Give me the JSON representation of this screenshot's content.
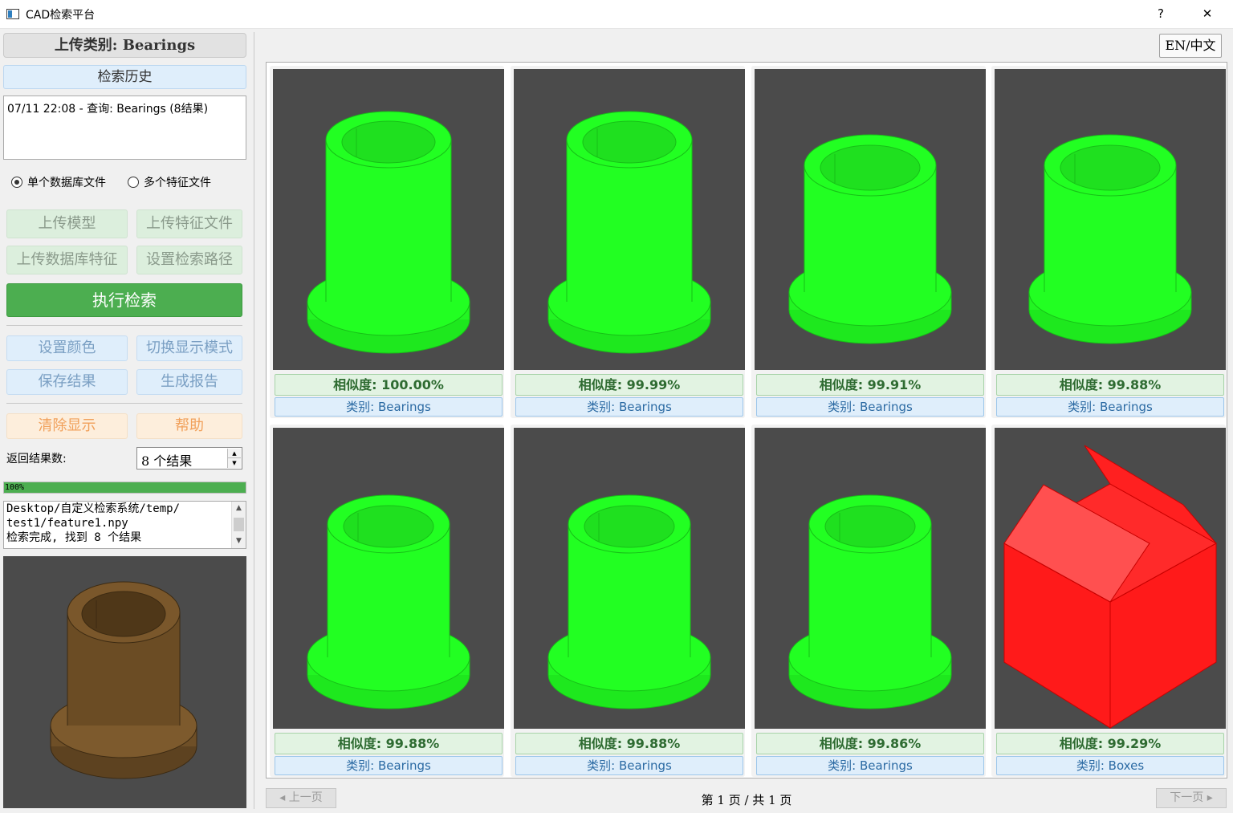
{
  "window": {
    "title": "CAD检索平台",
    "help": "?",
    "close": "✕"
  },
  "sidebar": {
    "upload_category": "上传类别: Bearings",
    "history_header": "检索历史",
    "history": [
      "07/11 22:08 - 查询: Bearings (8结果)"
    ],
    "radio_single": "单个数据库文件",
    "radio_multi": "多个特征文件",
    "radio_selected": "single",
    "btn_upload_model": "上传模型",
    "btn_upload_feature": "上传特征文件",
    "btn_upload_db_feature": "上传数据库特征",
    "btn_set_path": "设置检索路径",
    "btn_run": "执行检索",
    "btn_set_color": "设置颜色",
    "btn_toggle_display": "切换显示模式",
    "btn_save": "保存结果",
    "btn_report": "生成报告",
    "btn_clear": "清除显示",
    "btn_help": "帮助",
    "result_count_label": "返回结果数:",
    "result_count_value": "8 个结果",
    "progress_percent": 100,
    "progress_text": "100%",
    "log_lines": [
      "Desktop/自定义检索系统/temp/",
      "test1/feature1.npy",
      "检索完成, 找到 8 个结果"
    ],
    "colors": {
      "run_button": "#4cae50",
      "preview_model": "#6b4c24"
    }
  },
  "main": {
    "lang_toggle": "EN/中文",
    "results": [
      {
        "similarity": "相似度: 100.00%",
        "category": "类别: Bearings",
        "shape": "bearing-tall",
        "color": "#22ff22"
      },
      {
        "similarity": "相似度: 99.99%",
        "category": "类别: Bearings",
        "shape": "bearing-tall",
        "color": "#22ff22"
      },
      {
        "similarity": "相似度: 99.91%",
        "category": "类别: Bearings",
        "shape": "bearing-short",
        "color": "#22ff22"
      },
      {
        "similarity": "相似度: 99.88%",
        "category": "类别: Bearings",
        "shape": "bearing-short",
        "color": "#22ff22"
      },
      {
        "similarity": "相似度: 99.88%",
        "category": "类别: Bearings",
        "shape": "bearing-mid",
        "color": "#22ff22"
      },
      {
        "similarity": "相似度: 99.88%",
        "category": "类别: Bearings",
        "shape": "bearing-mid",
        "color": "#22ff22"
      },
      {
        "similarity": "相似度: 99.86%",
        "category": "类别: Bearings",
        "shape": "bearing-mid",
        "color": "#22ff22"
      },
      {
        "similarity": "相似度: 99.29%",
        "category": "类别: Boxes",
        "shape": "box",
        "color": "#ff1a1a"
      }
    ],
    "prev_page": "◂ 上一页",
    "next_page": "下一页 ▸",
    "page_info": "第 1 页 / 共 1 页"
  }
}
